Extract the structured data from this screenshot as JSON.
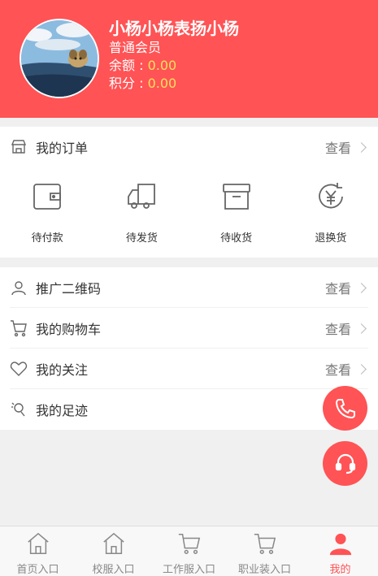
{
  "profile": {
    "name": "小杨小杨表扬小杨",
    "level": "普通会员",
    "balance_label": "余额 : ",
    "balance": "0.00",
    "points_label": "积分 : ",
    "points": "0.00"
  },
  "orders": {
    "title": "我的订单",
    "action": "查看",
    "items": [
      {
        "label": "待付款",
        "icon": "wallet-icon"
      },
      {
        "label": "待发货",
        "icon": "truck-icon"
      },
      {
        "label": "待收货",
        "icon": "box-icon"
      },
      {
        "label": "退换货",
        "icon": "refund-icon"
      }
    ]
  },
  "menu": [
    {
      "label": "推广二维码",
      "action": "查看",
      "icon": "user-icon"
    },
    {
      "label": "我的购物车",
      "action": "查看",
      "icon": "cart-icon"
    },
    {
      "label": "我的关注",
      "action": "查看",
      "icon": "heart-icon"
    },
    {
      "label": "我的足迹",
      "icon": "footprint-icon"
    }
  ],
  "tabbar": [
    {
      "label": "首页入口",
      "icon": "home-icon"
    },
    {
      "label": "校服入口",
      "icon": "home-icon"
    },
    {
      "label": "工作服入口",
      "icon": "cart-icon"
    },
    {
      "label": "职业装入口",
      "icon": "cart-icon"
    },
    {
      "label": "我的",
      "icon": "person-icon",
      "active": true
    }
  ],
  "colors": {
    "primary": "#ff5355",
    "highlight": "#ffe05b"
  }
}
